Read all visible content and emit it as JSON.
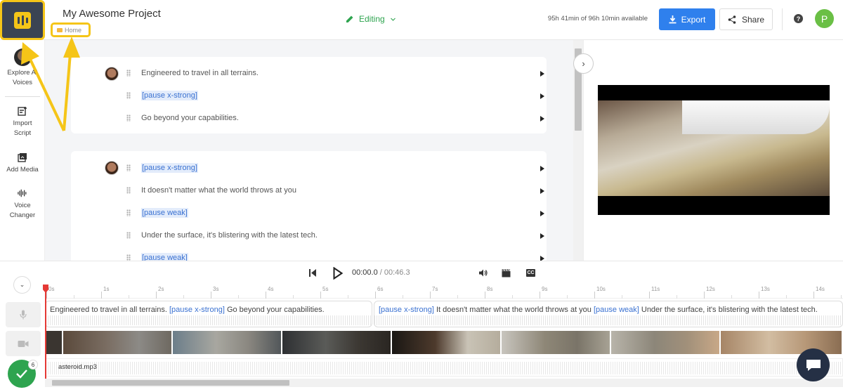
{
  "header": {
    "project_title": "My Awesome Project",
    "breadcrumb": "Home",
    "mode": "Editing",
    "availability": "95h 41min of 96h 10min available",
    "export_label": "Export",
    "share_label": "Share",
    "avatar_initial": "P",
    "help_glyph": "?"
  },
  "sidebar": {
    "items": [
      {
        "label": "Explore AI Voices",
        "icon": "voice-avatar-icon"
      },
      {
        "label": "Import Script",
        "icon": "import-script-icon"
      },
      {
        "label": "Add Media",
        "icon": "add-media-icon"
      },
      {
        "label": "Voice Changer",
        "icon": "voice-changer-icon"
      }
    ]
  },
  "script": {
    "blocks": [
      {
        "lines": [
          "Engineered to travel in all terrains.",
          "[pause x-strong]",
          "Go beyond your capabilities."
        ]
      },
      {
        "lines": [
          "[pause x-strong]",
          "It doesn't matter what the world throws at you",
          "[pause weak]",
          "Under the surface, it's blistering with the latest tech.",
          "[pause weak]"
        ]
      }
    ]
  },
  "player": {
    "current_time": "00:00.0",
    "separator": " / ",
    "total_time": "00:46.3",
    "cc_label": "CC"
  },
  "timeline": {
    "ruler_labels": [
      "0s",
      "1s",
      "2s",
      "3s",
      "4s",
      "5s",
      "6s",
      "7s",
      "8s",
      "9s",
      "10s",
      "11s",
      "12s",
      "13s",
      "14s"
    ],
    "voice_clips": [
      {
        "text_a": "Engineered to travel in all terrains.",
        "tag_a": "[pause x-strong]",
        "text_b": "Go beyond your capabilities."
      },
      {
        "tag_a": "[pause x-strong]",
        "text_a": "It doesn't matter what the world throws at you",
        "tag_b": "[pause weak]",
        "text_b": "Under the surface, it's blistering with the latest tech."
      }
    ],
    "audio_label": "asteroid.mp3",
    "status_count": "6"
  },
  "colors": {
    "accent_blue": "#2f80ed",
    "editing_green": "#2ea44f",
    "highlight_yellow": "#f5c518",
    "playhead_red": "#e53935",
    "tag_blue": "#3a71d1"
  }
}
